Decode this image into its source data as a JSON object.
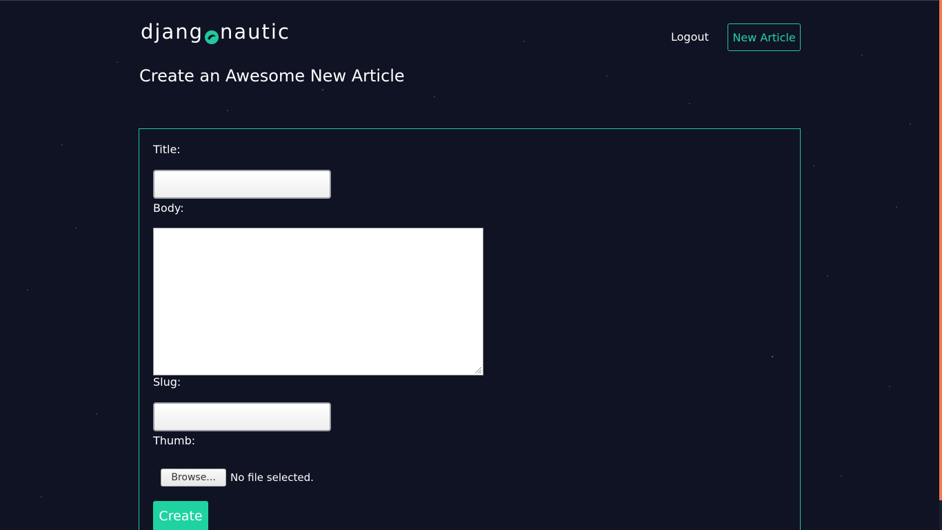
{
  "brand": {
    "logo_prefix": "djang",
    "logo_suffix": "nautic",
    "logo_icon": "circle-swirl-icon",
    "accent_color": "#22c8a0"
  },
  "nav": {
    "logout_label": "Logout",
    "new_article_label": "New Article"
  },
  "page": {
    "title": "Create an Awesome New Article"
  },
  "form": {
    "title_label": "Title:",
    "title_value": "",
    "body_label": "Body:",
    "body_value": "",
    "slug_label": "Slug:",
    "slug_value": "",
    "thumb_label": "Thumb:",
    "browse_label": "Browse...",
    "file_status": "No file selected.",
    "submit_label": "Create"
  }
}
